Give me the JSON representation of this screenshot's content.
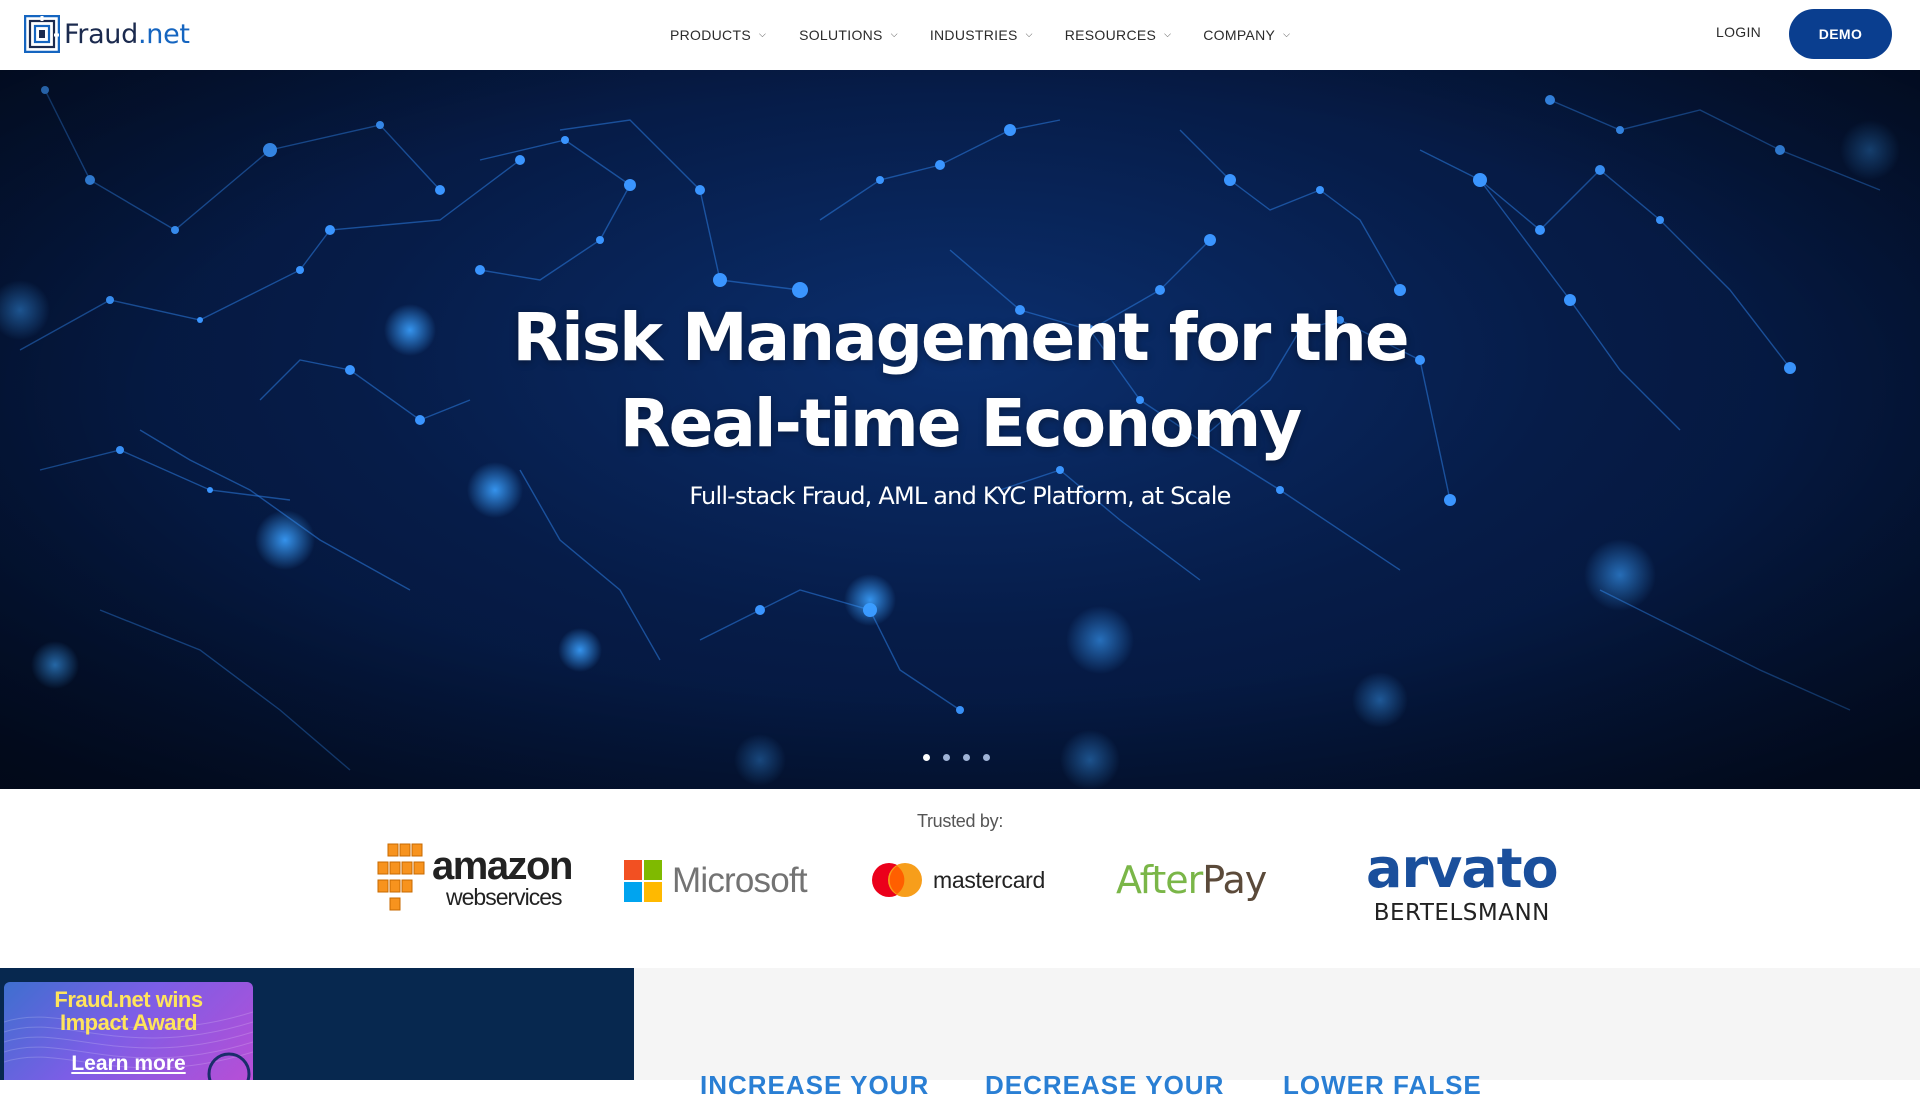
{
  "header": {
    "logo": {
      "text_main": "Fraud",
      "text_suffix": ".net"
    },
    "nav": [
      {
        "label": "PRODUCTS"
      },
      {
        "label": "SOLUTIONS"
      },
      {
        "label": "INDUSTRIES"
      },
      {
        "label": "RESOURCES"
      },
      {
        "label": "COMPANY"
      }
    ],
    "login_label": "LOGIN",
    "demo_label": "DEMO"
  },
  "hero": {
    "title_line1": "Risk Management for the",
    "title_line2": "Real-time Economy",
    "subtitle": "Full-stack Fraud, AML and KYC Platform, at Scale",
    "slide_count": 4,
    "active_slide": 1
  },
  "trusted": {
    "label": "Trusted by:",
    "logos": {
      "amazon": "amazon",
      "amazon_sub": "webservices",
      "microsoft": "Microsoft",
      "mastercard": "mastercard",
      "afterpay_a": "After",
      "afterpay_b": "Pay",
      "arvato": "arvato",
      "arvato_sub": "BERTELSMANN"
    }
  },
  "award": {
    "line1": "Fraud.net wins",
    "line2": "Impact Award",
    "link": "Learn more"
  },
  "peek_headings": [
    "INCREASE YOUR",
    "DECREASE YOUR",
    "LOWER FALSE"
  ],
  "colors": {
    "accent": "#0a3e8f",
    "hero_bg": "#061c48",
    "award_text": "#ffe45c"
  }
}
